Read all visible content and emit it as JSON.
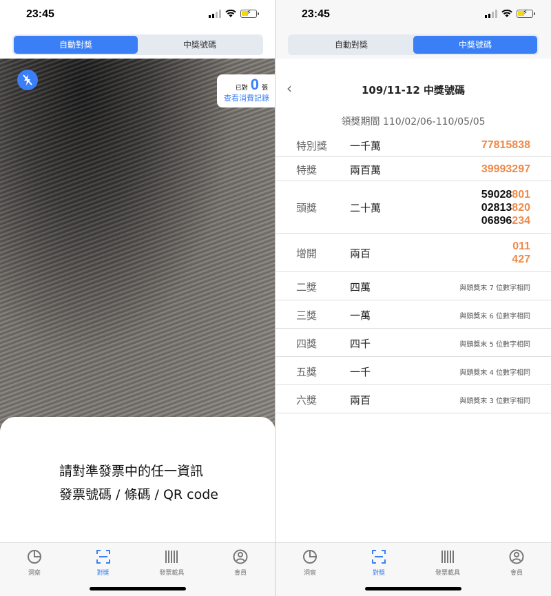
{
  "left": {
    "status": {
      "time": "23:45"
    },
    "segment": {
      "tab1": "自動對獎",
      "tab2": "中獎號碼"
    },
    "counter": {
      "prefix": "已對",
      "count": "0",
      "suffix": "張",
      "link": "查看消費記錄"
    },
    "sheet": {
      "line1": "請對準發票中的任一資訊",
      "line2": "發票號碼 / 條碼 / QR code"
    },
    "tabbar": [
      {
        "label": "洞察",
        "icon": "pie-chart-icon"
      },
      {
        "label": "對獎",
        "icon": "scan-icon"
      },
      {
        "label": "發票載具",
        "icon": "barcode-icon"
      },
      {
        "label": "會員",
        "icon": "user-icon"
      }
    ]
  },
  "right": {
    "status": {
      "time": "23:45"
    },
    "segment": {
      "tab1": "自動對獎",
      "tab2": "中獎號碼"
    },
    "header": {
      "back": "‹",
      "title": "109/11-12 中獎號碼"
    },
    "period": "領獎期間 110/02/06-110/05/05",
    "prizes": [
      {
        "name": "特別獎",
        "amount": "一千萬",
        "numbers": [
          [
            "",
            "77815838"
          ]
        ]
      },
      {
        "name": "特獎",
        "amount": "兩百萬",
        "numbers": [
          [
            "",
            "39993297"
          ]
        ]
      },
      {
        "name": "頭獎",
        "amount": "二十萬",
        "numbers": [
          [
            "59028",
            "801"
          ],
          [
            "02813",
            "820"
          ],
          [
            "06896",
            "234"
          ]
        ]
      },
      {
        "name": "增開",
        "amount": "兩百",
        "numbers": [
          [
            "",
            "011"
          ],
          [
            "",
            "427"
          ]
        ]
      },
      {
        "name": "二獎",
        "amount": "四萬",
        "note": "與頭獎末 7 位數字相同"
      },
      {
        "name": "三獎",
        "amount": "一萬",
        "note": "與頭獎末 6 位數字相同"
      },
      {
        "name": "四獎",
        "amount": "四千",
        "note": "與頭獎末 5 位數字相同"
      },
      {
        "name": "五獎",
        "amount": "一千",
        "note": "與頭獎末 4 位數字相同"
      },
      {
        "name": "六獎",
        "amount": "兩百",
        "note": "與頭獎末 3 位數字相同"
      }
    ],
    "tabbar": [
      {
        "label": "洞察",
        "icon": "pie-chart-icon"
      },
      {
        "label": "對獎",
        "icon": "scan-icon"
      },
      {
        "label": "發票載具",
        "icon": "barcode-icon"
      },
      {
        "label": "會員",
        "icon": "user-icon"
      }
    ]
  },
  "colors": {
    "accent": "#3a7ff6",
    "highlight": "#ee8a4a"
  }
}
